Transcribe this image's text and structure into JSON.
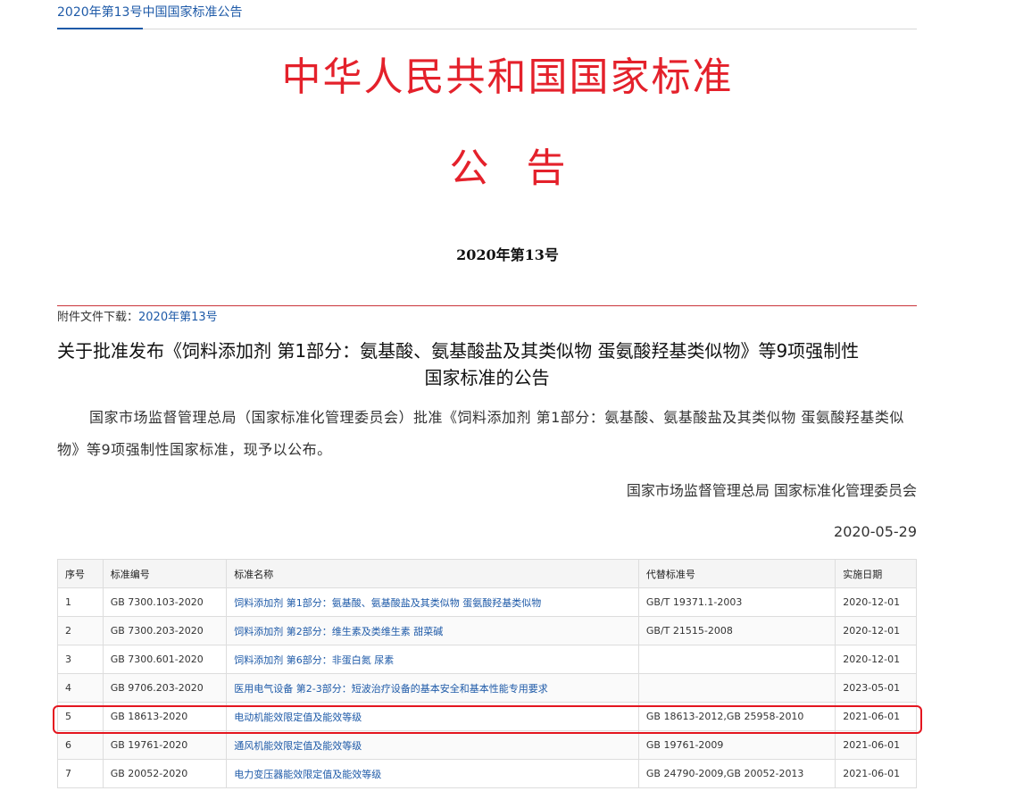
{
  "breadcrumb": "2020年第13号中国国家标准公告",
  "header": {
    "title": "中华人民共和国国家标准",
    "subtitle": "公告",
    "number": "2020年第13号"
  },
  "attachment": {
    "label": "附件文件下载：",
    "link": "2020年第13号"
  },
  "announcement": {
    "title_line1": "关于批准发布《饲料添加剂 第1部分：氨基酸、氨基酸盐及其类似物 蛋氨酸羟基类似物》等9项强制性",
    "title_line2": "国家标准的公告",
    "body": "国家市场监督管理总局（国家标准化管理委员会）批准《饲料添加剂 第1部分：氨基酸、氨基酸盐及其类似物 蛋氨酸羟基类似物》等9项强制性国家标准，现予以公布。",
    "signature": "国家市场监督管理总局 国家标准化管理委员会",
    "date": "2020-05-29"
  },
  "table": {
    "headers": [
      "序号",
      "标准编号",
      "标准名称",
      "代替标准号",
      "实施日期"
    ],
    "rows": [
      {
        "no": "1",
        "code": "GB 7300.103-2020",
        "name": "饲料添加剂 第1部分：氨基酸、氨基酸盐及其类似物 蛋氨酸羟基类似物",
        "replaces": "GB/T 19371.1-2003",
        "date": "2020-12-01"
      },
      {
        "no": "2",
        "code": "GB 7300.203-2020",
        "name": "饲料添加剂 第2部分：维生素及类维生素 甜菜碱",
        "replaces": "GB/T 21515-2008",
        "date": "2020-12-01"
      },
      {
        "no": "3",
        "code": "GB 7300.601-2020",
        "name": "饲料添加剂 第6部分：非蛋白氮 尿素",
        "replaces": "",
        "date": "2020-12-01"
      },
      {
        "no": "4",
        "code": "GB 9706.203-2020",
        "name": "医用电气设备 第2-3部分：短波治疗设备的基本安全和基本性能专用要求",
        "replaces": "",
        "date": "2023-05-01"
      },
      {
        "no": "5",
        "code": "GB 18613-2020",
        "name": "电动机能效限定值及能效等级",
        "replaces": "GB 18613-2012,GB 25958-2010",
        "date": "2021-06-01"
      },
      {
        "no": "6",
        "code": "GB 19761-2020",
        "name": "通风机能效限定值及能效等级",
        "replaces": "GB 19761-2009",
        "date": "2021-06-01"
      },
      {
        "no": "7",
        "code": "GB 20052-2020",
        "name": "电力变压器能效限定值及能效等级",
        "replaces": "GB 24790-2009,GB 20052-2013",
        "date": "2021-06-01"
      }
    ]
  }
}
